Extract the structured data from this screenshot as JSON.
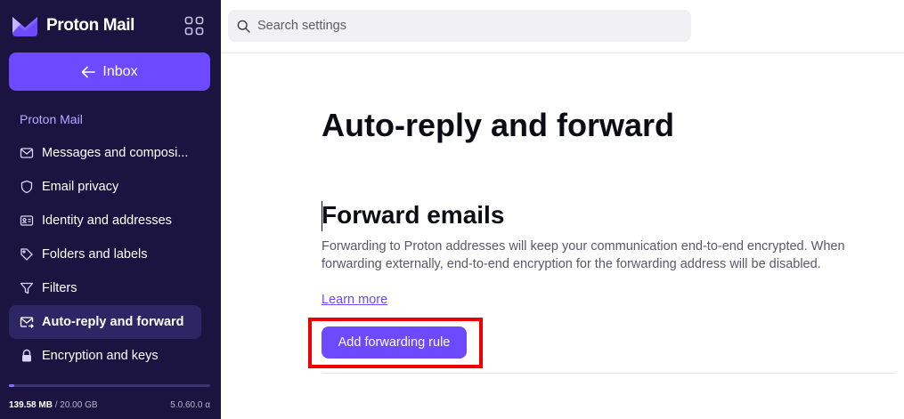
{
  "brand": {
    "name": "Proton Mail"
  },
  "sidebar": {
    "inbox_button": "Inbox",
    "section_label": "Proton Mail",
    "items": [
      {
        "label": "Messages and composi...",
        "icon": "envelope-icon",
        "active": false
      },
      {
        "label": "Email privacy",
        "icon": "shield-icon",
        "active": false
      },
      {
        "label": "Identity and addresses",
        "icon": "id-card-icon",
        "active": false
      },
      {
        "label": "Folders and labels",
        "icon": "tag-icon",
        "active": false
      },
      {
        "label": "Filters",
        "icon": "filter-icon",
        "active": false
      },
      {
        "label": "Auto-reply and forward",
        "icon": "envelope-forward-icon",
        "active": true
      },
      {
        "label": "Encryption and keys",
        "icon": "lock-icon",
        "active": false
      }
    ],
    "storage": {
      "used": "139.58 MB",
      "separator": " / ",
      "total": "20.00 GB",
      "used_fraction": 0.0068
    },
    "version": "5.0.60.0 α"
  },
  "search": {
    "placeholder": "Search settings",
    "value": ""
  },
  "main": {
    "page_title": "Auto-reply and forward",
    "section_title": "Forward emails",
    "description": "Forwarding to Proton addresses will keep your communication end-to-end encrypted. When forwarding externally, end-to-end encryption for the forwarding address will be disabled.",
    "learn_more": "Learn more",
    "add_button": "Add forwarding rule"
  },
  "colors": {
    "sidebar_bg": "#1b1340",
    "accent": "#6d4aff",
    "active_item_bg": "#2e2565",
    "highlight": "#ee0000"
  }
}
